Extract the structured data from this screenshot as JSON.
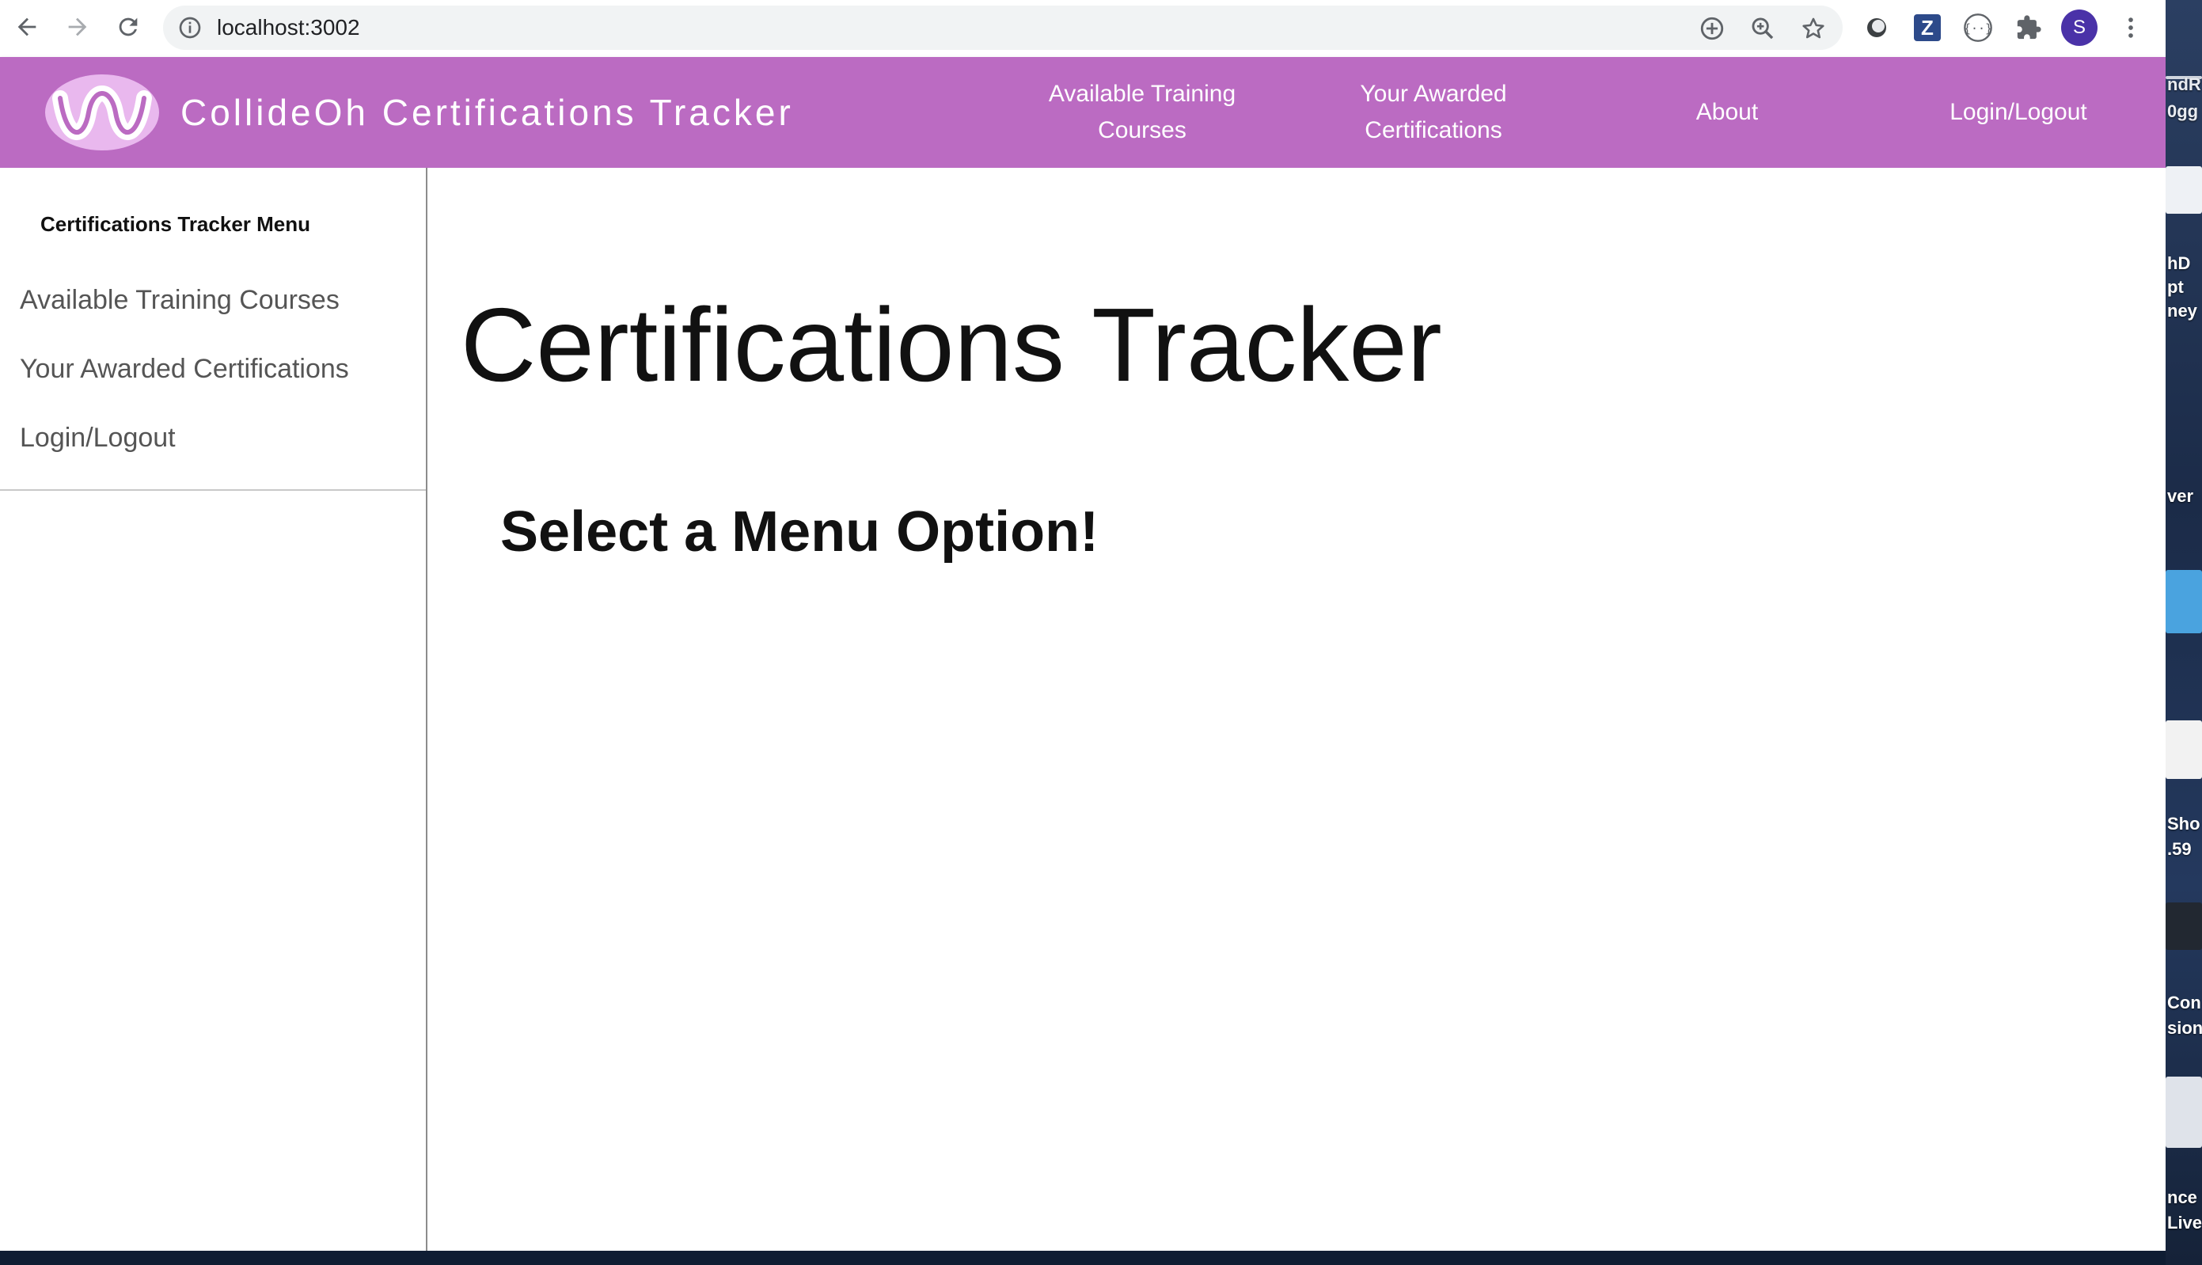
{
  "browser": {
    "url": "localhost:3002",
    "profile_initial": "S",
    "extension_z_label": "Z"
  },
  "header": {
    "title": "CollideOh Certifications Tracker",
    "nav": [
      {
        "label_line1": "Available Training",
        "label_line2": "Courses"
      },
      {
        "label_line1": "Your Awarded",
        "label_line2": "Certifications"
      },
      {
        "label": "About"
      },
      {
        "label": "Login/Logout"
      }
    ],
    "brand_color": "#bb6bc2"
  },
  "sidebar": {
    "heading": "Certifications Tracker Menu",
    "items": [
      {
        "label": "Available Training Courses"
      },
      {
        "label": "Your Awarded Certifications"
      },
      {
        "label": "Login/Logout"
      }
    ]
  },
  "main": {
    "title": "Certifications Tracker",
    "subtitle": "Select a Menu Option!"
  },
  "desktop": {
    "fragments": [
      "ndR",
      "0gg",
      "hD",
      "pt",
      "ney",
      "ver",
      "Sho",
      ".59",
      "Con",
      "sion",
      "nce",
      "Live"
    ]
  }
}
